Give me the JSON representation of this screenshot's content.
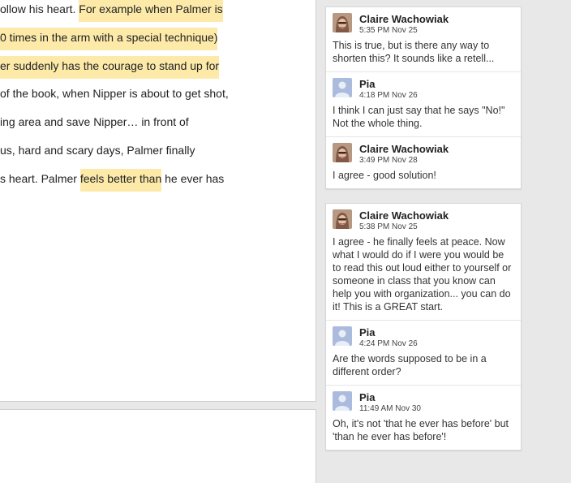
{
  "document": {
    "lines": [
      {
        "pre": "ollow his heart. ",
        "hl": "For example when Palmer is",
        "post": ""
      },
      {
        "pre": "",
        "hl": "0 times in the arm with a special technique)",
        "post": ""
      },
      {
        "pre": "",
        "hl": "er suddenly has the courage to stand up for",
        "post": ""
      },
      {
        "pre": "of the book, when Nipper is about to get shot,",
        "hl": "",
        "post": ""
      },
      {
        "pre": "ing area and save Nipper… in front of",
        "hl": "",
        "post": ""
      },
      {
        "pre": "us, hard and scary days, Palmer finally",
        "hl": "",
        "post": ""
      },
      {
        "pre": "s heart. Palmer ",
        "hl": "feels better than",
        "post": " he ever has"
      }
    ]
  },
  "threads": [
    {
      "comments": [
        {
          "author": "Claire Wachowiak",
          "time": "5:35 PM Nov 25",
          "avatar": "photo",
          "text": "This is true, but is there any way to shorten this? It sounds like a retell..."
        },
        {
          "author": "Pia",
          "time": "4:18 PM Nov 26",
          "avatar": "default",
          "text": "I think I can just say that he says \"No!\" Not the whole thing."
        },
        {
          "author": "Claire Wachowiak",
          "time": "3:49 PM Nov 28",
          "avatar": "photo",
          "text": "I agree - good solution!"
        }
      ]
    },
    {
      "comments": [
        {
          "author": "Claire Wachowiak",
          "time": "5:38 PM Nov 25",
          "avatar": "photo",
          "text": "I agree - he finally feels at peace. Now what I would do if I were you would be to read this out loud either to yourself or someone in class that you know can help you with organization... you can do it! This is a GREAT start."
        },
        {
          "author": "Pia",
          "time": "4:24 PM Nov 26",
          "avatar": "default",
          "text": "Are the words supposed to be in a different order?"
        },
        {
          "author": "Pia",
          "time": "11:49 AM Nov 30",
          "avatar": "default",
          "text": "Oh, it's not 'that he ever has before' but 'than he ever has before'!"
        }
      ]
    }
  ]
}
